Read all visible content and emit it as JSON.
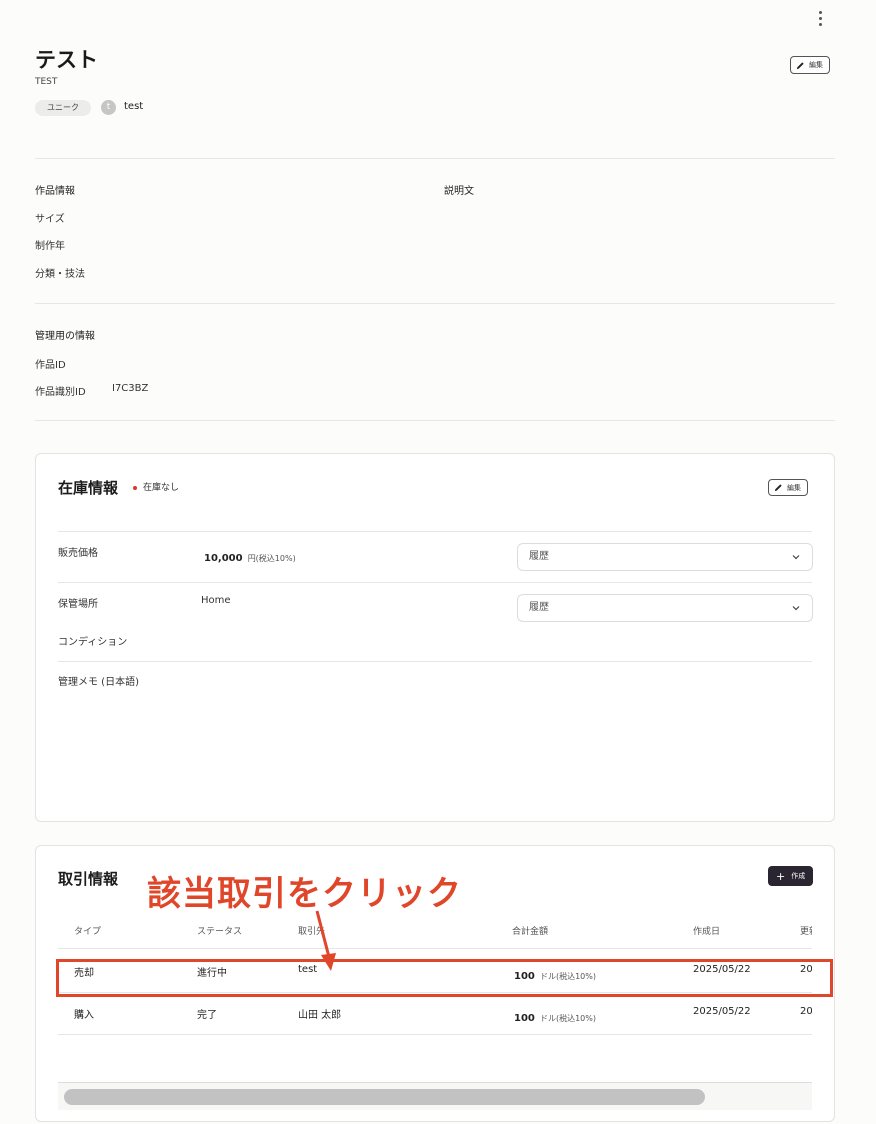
{
  "header": {
    "title": "テスト",
    "subtitle": "TEST",
    "tag": "ユニーク",
    "owner_initial": "t",
    "owner_name": "test",
    "edit_label": "編集"
  },
  "artwork_info": {
    "heading": "作品情報",
    "size_label": "サイズ",
    "year_label": "制作年",
    "category_label": "分類・技法",
    "description_heading": "説明文"
  },
  "admin_info": {
    "heading": "管理用の情報",
    "work_id_label": "作品ID",
    "identifier_label": "作品識別ID",
    "identifier_value": "I7C3BZ"
  },
  "inventory": {
    "title": "在庫情報",
    "status": "在庫なし",
    "edit_label": "編集",
    "price_label": "販売価格",
    "price_value": "10,000",
    "price_unit": "円(税込10%)",
    "location_label": "保管場所",
    "location_value": "Home",
    "condition_label": "コンディション",
    "memo_label": "管理メモ (日本語)",
    "history_select_1": "履歴",
    "history_select_2": "履歴",
    "colors": {
      "status_dot": "#d63b2a"
    }
  },
  "transactions": {
    "title": "取引情報",
    "create_label": "作成",
    "columns": [
      "タイプ",
      "ステータス",
      "取引先",
      "合計金額",
      "作成日",
      "更新"
    ],
    "rows": [
      {
        "type": "売却",
        "status": "進行中",
        "partner": "test",
        "amount": "100",
        "unit": "ドル(税込10%)",
        "created": "2025/05/22",
        "updated": "20"
      },
      {
        "type": "購入",
        "status": "完了",
        "partner": "山田 太郎",
        "amount": "100",
        "unit": "ドル(税込10%)",
        "created": "2025/05/22",
        "updated": "20"
      }
    ]
  },
  "annotation": {
    "callout": "該当取引をクリック",
    "color": "#e0462a"
  }
}
